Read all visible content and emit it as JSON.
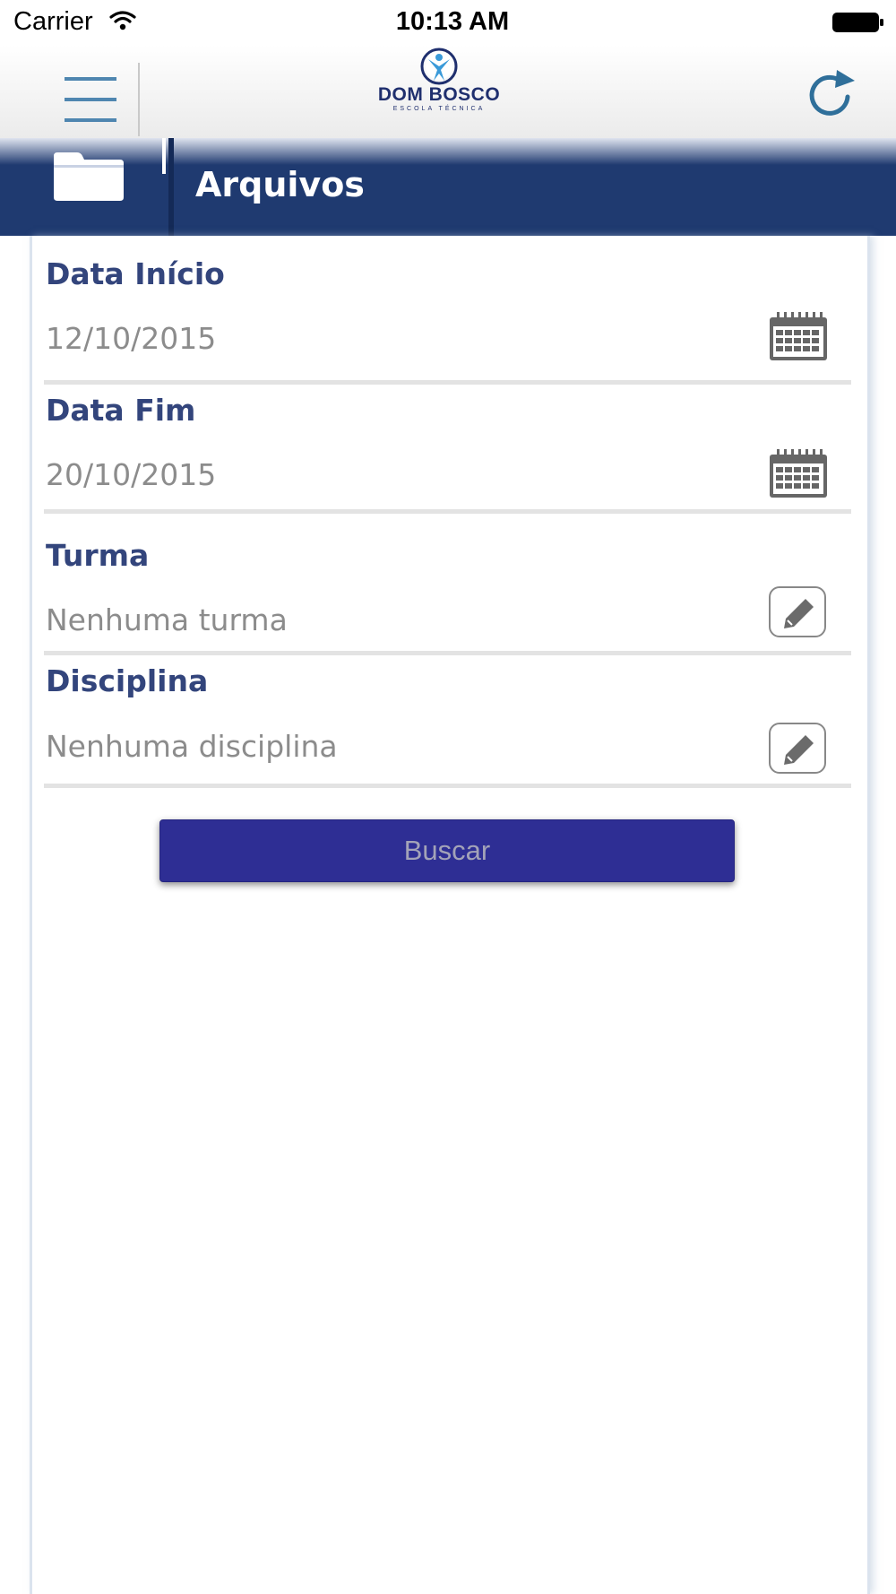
{
  "status_bar": {
    "carrier": "Carrier",
    "time": "10:13 AM"
  },
  "navbar": {
    "logo": {
      "name": "DOM BOSCO",
      "subtitle": "ESCOLA TÉCNICA"
    },
    "icons": [
      "menu-icon",
      "refresh-icon"
    ]
  },
  "header": {
    "title": "Arquivos",
    "icon": "folder-icon",
    "color": "#1f3a70"
  },
  "form": {
    "data_inicio": {
      "label": "Data Início",
      "value": "12/10/2015",
      "icon": "calendar-icon"
    },
    "data_fim": {
      "label": "Data Fim",
      "value": "20/10/2015",
      "icon": "calendar-icon"
    },
    "turma": {
      "label": "Turma",
      "value": "Nenhuma turma",
      "icon": "pencil-icon"
    },
    "disciplina": {
      "label": "Disciplina",
      "value": "Nenhuma disciplina",
      "icon": "pencil-icon"
    },
    "search_label": "Buscar",
    "search_color": "#2e2e94"
  }
}
